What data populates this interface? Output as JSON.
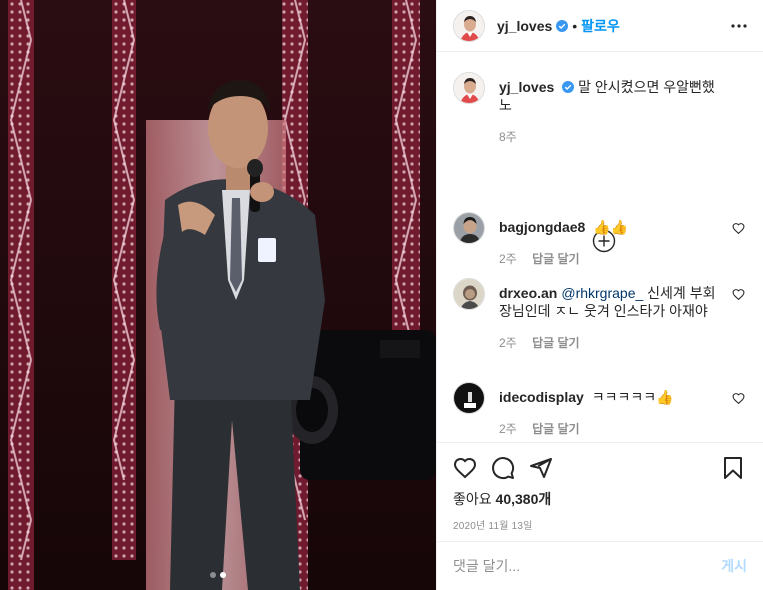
{
  "photo": {
    "carousel": {
      "count": 2,
      "active_index": 1
    }
  },
  "header": {
    "username": "yj_loves",
    "separator": "•",
    "follow_label": "팔로우"
  },
  "caption": {
    "username": "yj_loves",
    "text": "말 안시켰으면 우알뻔했노",
    "time": "8주"
  },
  "comments": [
    {
      "username": "bagjongdae8",
      "text": "👍👍",
      "time": "2주",
      "reply_label": "답글 달기"
    },
    {
      "username": "drxeo.an",
      "mention": "@rhkrgrape_",
      "text": " 신세계 부회장님인데 ㅈㄴ 웃겨 인스타가 아재야",
      "time": "2주",
      "reply_label": "답글 달기"
    },
    {
      "username": "idecodisplay",
      "text": "ㅋㅋㅋㅋㅋ👍",
      "time": "2주",
      "reply_label": "답글 달기"
    }
  ],
  "likes": {
    "label": "좋아요",
    "count": "40,380개"
  },
  "date": "2020년 11월 13일",
  "add_comment": {
    "placeholder": "댓글 달기...",
    "post_label": "게시"
  },
  "colors": {
    "link_blue": "#0095f6",
    "verified_blue": "#3897f0",
    "stage_pink": "#e8a7b5",
    "muted": "#8e8e8e"
  }
}
